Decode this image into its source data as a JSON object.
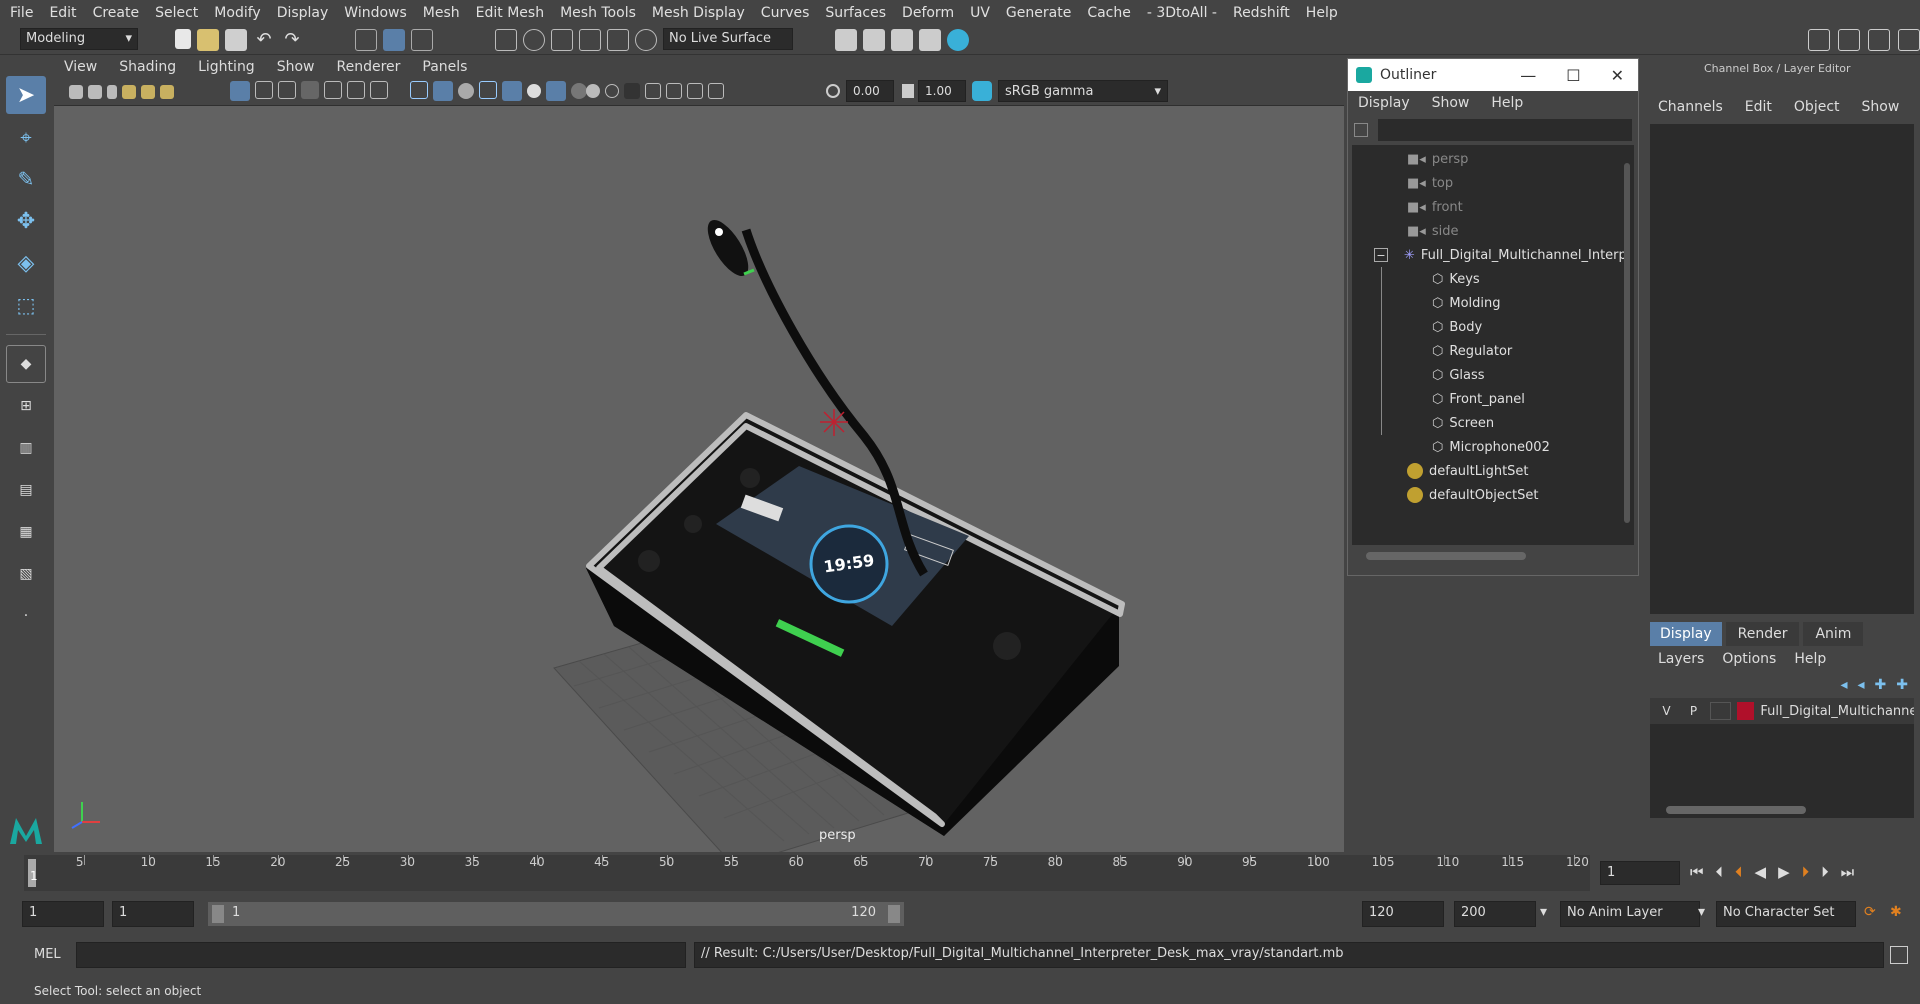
{
  "menubar": {
    "items": [
      "File",
      "Edit",
      "Create",
      "Select",
      "Modify",
      "Display",
      "Windows",
      "Mesh",
      "Edit Mesh",
      "Mesh Tools",
      "Mesh Display",
      "Curves",
      "Surfaces",
      "Deform",
      "UV",
      "Generate",
      "Cache",
      "- 3DtoAll -",
      "Redshift",
      "Help"
    ]
  },
  "shelf": {
    "mode": "Modeling",
    "live_surface": "No Live Surface"
  },
  "viewport": {
    "menu": [
      "View",
      "Shading",
      "Lighting",
      "Show",
      "Renderer",
      "Panels"
    ],
    "exposure": "0.00",
    "gamma": "1.00",
    "colorspace": "sRGB gamma",
    "camera_label": "persp",
    "screen_time": "19:59"
  },
  "outliner": {
    "title": "Outliner",
    "menu": [
      "Display",
      "Show",
      "Help"
    ],
    "cameras": [
      "persp",
      "top",
      "front",
      "side"
    ],
    "group": "Full_Digital_Multichannel_Interp",
    "children": [
      "Keys",
      "Molding",
      "Body",
      "Regulator",
      "Glass",
      "Front_panel",
      "Screen",
      "Microphone002"
    ],
    "sets": [
      "defaultLightSet",
      "defaultObjectSet"
    ]
  },
  "channelbox": {
    "title": "Channel Box / Layer Editor",
    "menu": [
      "Channels",
      "Edit",
      "Object",
      "Show"
    ],
    "tabs": [
      "Display",
      "Render",
      "Anim"
    ],
    "layer_menu": [
      "Layers",
      "Options",
      "Help"
    ],
    "layer": {
      "v": "V",
      "p": "P",
      "name": "Full_Digital_Multichannel",
      "color": "#b0102a"
    }
  },
  "timeline": {
    "ticks": [
      "5",
      "10",
      "15",
      "20",
      "25",
      "30",
      "35",
      "40",
      "45",
      "50",
      "55",
      "60",
      "65",
      "70",
      "75",
      "80",
      "85",
      "90",
      "95",
      "100",
      "105",
      "110",
      "115",
      "120"
    ],
    "first": "1",
    "current_frame": "1"
  },
  "range": {
    "start": "1",
    "start2": "1",
    "slider_start": "1",
    "slider_end": "120",
    "end": "120",
    "end2": "200",
    "anim_layer": "No Anim Layer",
    "char_set": "No Character Set"
  },
  "mel": {
    "label": "MEL",
    "result": "// Result: C:/Users/User/Desktop/Full_Digital_Multichannel_Interpreter_Desk_max_vray/standart.mb"
  },
  "status": {
    "text": "Select Tool: select an object"
  }
}
